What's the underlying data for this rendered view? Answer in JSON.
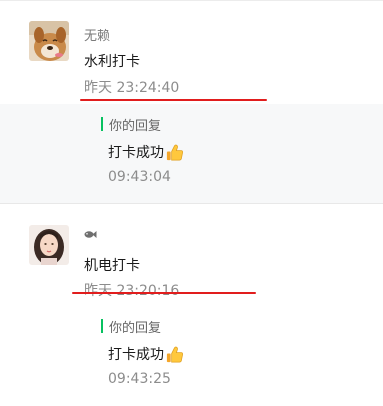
{
  "messages": [
    {
      "author": "无赖",
      "content": "水利打卡",
      "timestamp": "昨天 23:24:40",
      "reply": {
        "label": "你的回复",
        "text": "打卡成功",
        "emoji": "thumbs-up-icon",
        "time": "09:43:04"
      },
      "avatar": "dog-avatar"
    },
    {
      "author_icon": "fish-icon",
      "content": "机电打卡",
      "timestamp": "昨天 23:20:16",
      "reply": {
        "label": "你的回复",
        "text": "打卡成功",
        "emoji": "thumbs-up-icon",
        "time": "09:43:25"
      },
      "avatar": "girl-avatar"
    }
  ],
  "colors": {
    "accent_green": "#07c160",
    "highlight_red": "#e11d1d",
    "reply_bg": "#f7f8f9",
    "muted_text": "#8c8c8c"
  }
}
